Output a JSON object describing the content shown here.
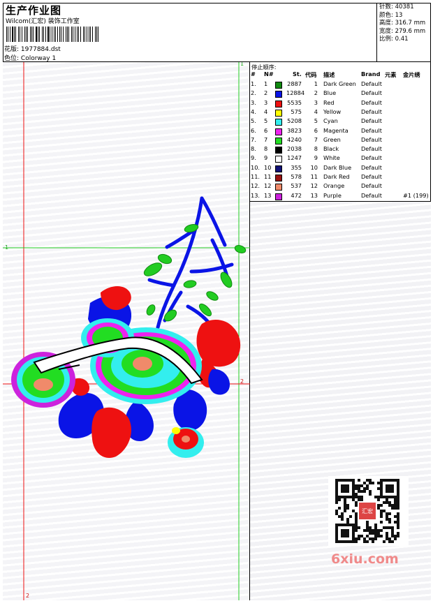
{
  "header": {
    "title": "生产作业图",
    "company": "Wilcom(汇宏) 装饰工作室",
    "file_label": "花版:",
    "file_value": "1977884.dst",
    "colorway_label": "色位:",
    "colorway_value": "Colorway 1"
  },
  "stats": [
    {
      "label": "针数:",
      "value": "40381"
    },
    {
      "label": "颜色:",
      "value": "13"
    },
    {
      "label": "高度:",
      "value": "316.7 mm"
    },
    {
      "label": "宽度:",
      "value": "279.6 mm"
    },
    {
      "label": "比例:",
      "value": "0.41"
    }
  ],
  "stop_sequence": {
    "title": "停止顺序:",
    "headers": {
      "index": "#",
      "needle": "N#",
      "stitches": "St.",
      "code": "代码",
      "description": "描述",
      "brand": "Brand",
      "element": "元素",
      "sequin": "金片绣"
    },
    "rows": [
      {
        "index": "1.",
        "needle": "1",
        "color": "#118a11",
        "stitches": "2887",
        "code": "1",
        "description": "Dark Green",
        "brand": "Default",
        "note": ""
      },
      {
        "index": "2.",
        "needle": "2",
        "color": "#0a14e6",
        "stitches": "12884",
        "code": "2",
        "description": "Blue",
        "brand": "Default",
        "note": ""
      },
      {
        "index": "3.",
        "needle": "3",
        "color": "#ee1111",
        "stitches": "5535",
        "code": "3",
        "description": "Red",
        "brand": "Default",
        "note": ""
      },
      {
        "index": "4.",
        "needle": "4",
        "color": "#ffff00",
        "stitches": "575",
        "code": "4",
        "description": "Yellow",
        "brand": "Default",
        "note": ""
      },
      {
        "index": "5.",
        "needle": "5",
        "color": "#33eeee",
        "stitches": "5208",
        "code": "5",
        "description": "Cyan",
        "brand": "Default",
        "note": ""
      },
      {
        "index": "6.",
        "needle": "6",
        "color": "#ee22ee",
        "stitches": "3823",
        "code": "6",
        "description": "Magenta",
        "brand": "Default",
        "note": ""
      },
      {
        "index": "7.",
        "needle": "7",
        "color": "#22dd22",
        "stitches": "4240",
        "code": "7",
        "description": "Green",
        "brand": "Default",
        "note": ""
      },
      {
        "index": "8.",
        "needle": "8",
        "color": "#000000",
        "stitches": "2038",
        "code": "8",
        "description": "Black",
        "brand": "Default",
        "note": ""
      },
      {
        "index": "9.",
        "needle": "9",
        "color": "#ffffff",
        "stitches": "1247",
        "code": "9",
        "description": "White",
        "brand": "Default",
        "note": ""
      },
      {
        "index": "10.",
        "needle": "10",
        "color": "#111177",
        "stitches": "355",
        "code": "10",
        "description": "Dark Blue",
        "brand": "Default",
        "note": ""
      },
      {
        "index": "11.",
        "needle": "11",
        "color": "#991111",
        "stitches": "578",
        "code": "11",
        "description": "Dark Red",
        "brand": "Default",
        "note": ""
      },
      {
        "index": "12.",
        "needle": "12",
        "color": "#f08a6a",
        "stitches": "537",
        "code": "12",
        "description": "Orange",
        "brand": "Default",
        "note": ""
      },
      {
        "index": "13.",
        "needle": "13",
        "color": "#cc22dd",
        "stitches": "472",
        "code": "13",
        "description": "Purple",
        "brand": "Default",
        "note": "#1 (199)"
      }
    ]
  },
  "guides": {
    "v1": "1",
    "v2": "2",
    "h1": "1",
    "h2": "2"
  },
  "watermark": "6xiu.com",
  "seal_text": "汇宏"
}
